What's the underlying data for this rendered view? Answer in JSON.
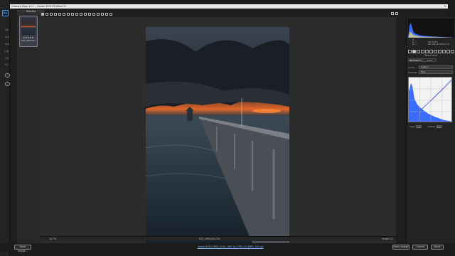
{
  "photoshop": {
    "logo": "Ps",
    "left_strip_labels": [
      "Ne",
      "Lea",
      "Lea",
      "Lig",
      "Cle",
      "Dr"
    ]
  },
  "window": {
    "title": "Camera Raw 11.1  –  Canon EOS 5D Mark IV",
    "close": "×"
  },
  "filmstrip": {
    "header": "Filmstrip",
    "thumbnail": {
      "stars": "★★★★★",
      "filename": "EOS_5P65200.CR2"
    }
  },
  "status": {
    "zoom": "16.7%",
    "filename": "EOS_5P65200.CR2",
    "page": "Image 1/1"
  },
  "bottom": {
    "save_button": "Save Image...",
    "workflow_link": "Adobe RGB (1998); 8 bit; 3967 by 5760 (22.8MP); 300 ppi",
    "open_button": "Open Image",
    "cancel_button": "Cancel",
    "done_button": "Done"
  },
  "histogram": {
    "readout_r": "R: ---",
    "readout_g": "G: ---",
    "readout_b": "B: ---",
    "readout_f": "f/10   1/25 s",
    "readout_iso": "ISO 100   16-35@35 mm"
  },
  "panel": {
    "title": "Tone Curve",
    "tab_parametric": "Parametric",
    "tab_point": "Point",
    "curve_label": "Curve:",
    "curve_value": "Custom",
    "channel_label": "Channel:",
    "channel_value": "Blue",
    "input_label": "Input:",
    "input_value": "128",
    "output_label": "Output:",
    "output_value": "128"
  },
  "colors": {
    "accent": "#31a8ff",
    "background": "#1e1e1e",
    "histogram_blue": "#3a6cff"
  }
}
